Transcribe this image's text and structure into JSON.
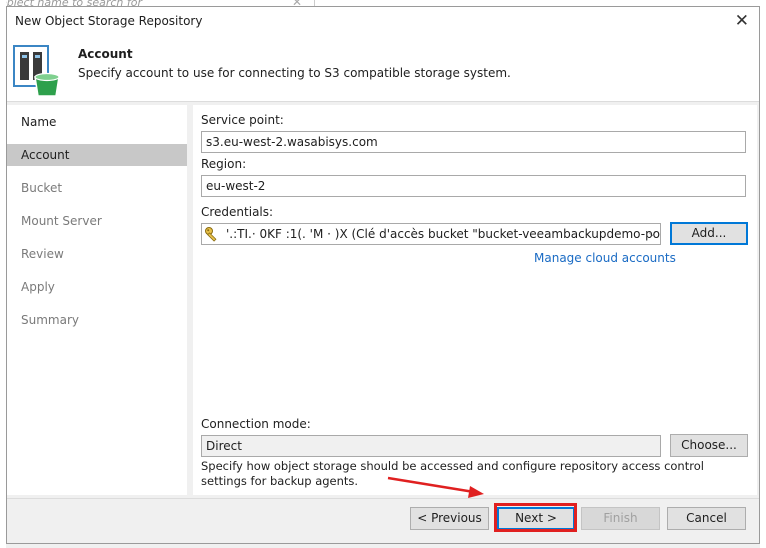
{
  "background": {
    "search_hint": "object name to search for"
  },
  "dialog": {
    "title": "New Object Storage Repository",
    "header": {
      "title": "Account",
      "subtitle": "Specify account to use for connecting to S3 compatible storage system."
    },
    "nav": [
      {
        "label": "Name"
      },
      {
        "label": "Account"
      },
      {
        "label": "Bucket"
      },
      {
        "label": "Mount Server"
      },
      {
        "label": "Review"
      },
      {
        "label": "Apply"
      },
      {
        "label": "Summary"
      }
    ],
    "service_point": {
      "label": "Service point:",
      "value": "s3.eu-west-2.wasabisys.com"
    },
    "region": {
      "label": "Region:",
      "value": "eu-west-2"
    },
    "credentials": {
      "label": "Credentials:",
      "value": "'.:TI.·  0KF  :1(.  'M · )X   (Clé d'accès bucket \"bucket-veeambackupdemo-pol",
      "add_label": "Add...",
      "manage_link": "Manage cloud accounts"
    },
    "connection_mode": {
      "label": "Connection mode:",
      "value": "Direct",
      "choose_label": "Choose...",
      "description": "Specify how object storage should be accessed and configure repository access control settings for backup agents."
    },
    "buttons": {
      "previous": "< Previous",
      "next": "Next >",
      "finish": "Finish",
      "cancel": "Cancel"
    },
    "colors": {
      "highlight": "#e02020",
      "link": "#1a6bc4",
      "nav_active": "#c8c8c8"
    }
  }
}
